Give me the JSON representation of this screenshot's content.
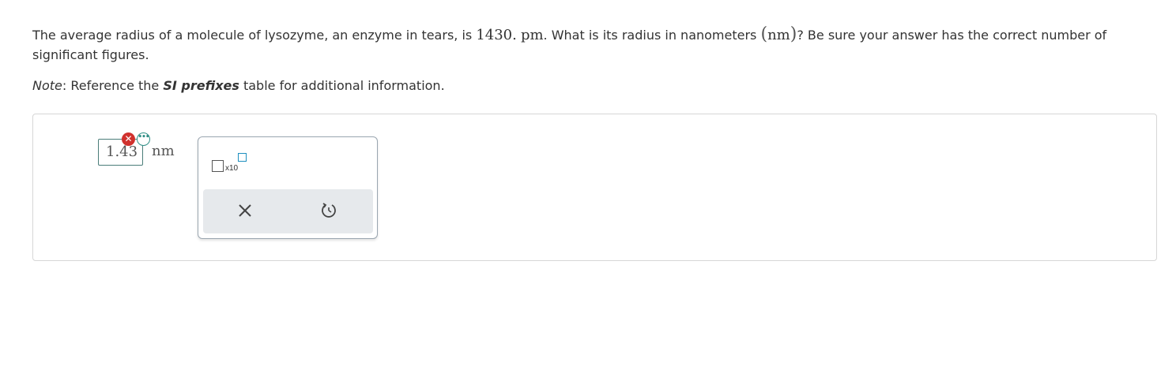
{
  "question": {
    "text_part1": "The average radius of a molecule of lysozyme, an enzyme in tears, is ",
    "value": "1430.",
    "value_unit": "pm",
    "text_part2": ". What is its radius in nanometers ",
    "paren_open": "(",
    "unit_nm": "nm",
    "paren_close": ")",
    "text_part3": "? Be sure your answer has the correct number of significant figures."
  },
  "note": {
    "label": "Note",
    "colon_text": ": Reference the ",
    "link_text": "SI prefixes",
    "rest": " table for additional information."
  },
  "answer": {
    "input_value": "1.43",
    "unit": "nm",
    "status": "incorrect"
  },
  "tools": {
    "sci_notation_label": "x10",
    "clear_icon": "close-icon",
    "reset_icon": "undo-icon"
  },
  "colors": {
    "incorrect": "#d0312d",
    "accent": "#2f8f86",
    "exponent_box": "#1e8fbf"
  }
}
